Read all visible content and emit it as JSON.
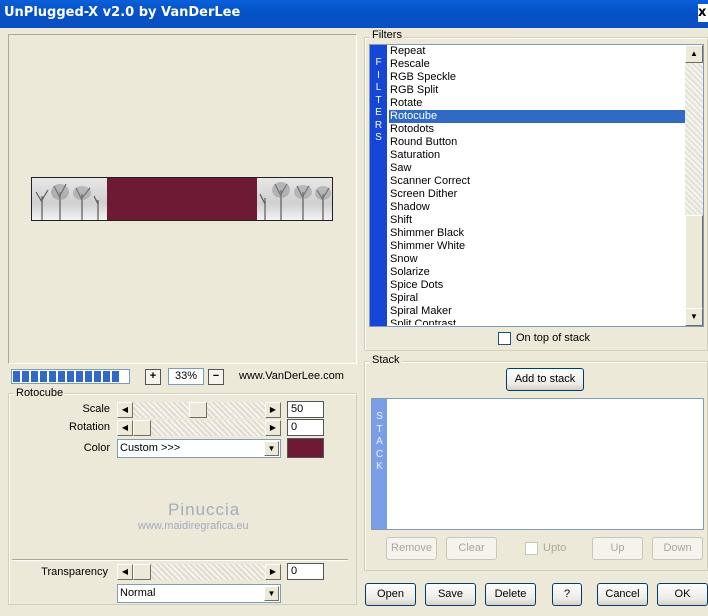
{
  "window": {
    "title": "UnPlugged-X v2.0 by VanDerLee",
    "close_glyph": "x"
  },
  "preview": {
    "zoom_in": "+",
    "zoom_out": "−",
    "zoom": "33%",
    "website": "www.VanDerLee.com",
    "progress_blocks": 12
  },
  "effect": {
    "group_label": "Rotocube",
    "scale_label": "Scale",
    "scale_value": "50",
    "rotation_label": "Rotation",
    "rotation_value": "0",
    "color_label": "Color",
    "color_select": "Custom >>>",
    "color_swatch": "#6e1a34"
  },
  "watermark": {
    "name": "Pinuccia",
    "site": "www.maidiregrafica.eu"
  },
  "transparency": {
    "label": "Transparency",
    "value": "0",
    "blend_mode": "Normal"
  },
  "filters": {
    "group_label": "Filters",
    "vertical_label": [
      "F",
      "I",
      "L",
      "T",
      "E",
      "R",
      "S"
    ],
    "items": [
      "Repeat",
      "Rescale",
      "RGB Speckle",
      "RGB Split",
      "Rotate",
      "Rotocube",
      "Rotodots",
      "Round Button",
      "Saturation",
      "Saw",
      "Scanner Correct",
      "Screen Dither",
      "Shadow",
      "Shift",
      "Shimmer Black",
      "Shimmer White",
      "Snow",
      "Solarize",
      "Spice Dots",
      "Spiral",
      "Spiral Maker",
      "Split Contrast"
    ],
    "selected": "Rotocube",
    "on_top_label": "On top of stack"
  },
  "stack": {
    "group_label": "Stack",
    "add_button": "Add to stack",
    "vertical_label": [
      "S",
      "T",
      "A",
      "C",
      "K"
    ],
    "remove": "Remove",
    "clear": "Clear",
    "upto": "Upto",
    "up": "Up",
    "down": "Down"
  },
  "footer": {
    "open": "Open",
    "save": "Save",
    "delete": "Delete",
    "help": "?",
    "cancel": "Cancel",
    "ok": "OK"
  },
  "colors": {
    "titlebar": "#0552c8",
    "selection": "#316ac5",
    "filters_bar": "#1646d6",
    "stack_bar": "#7b9ee9"
  }
}
